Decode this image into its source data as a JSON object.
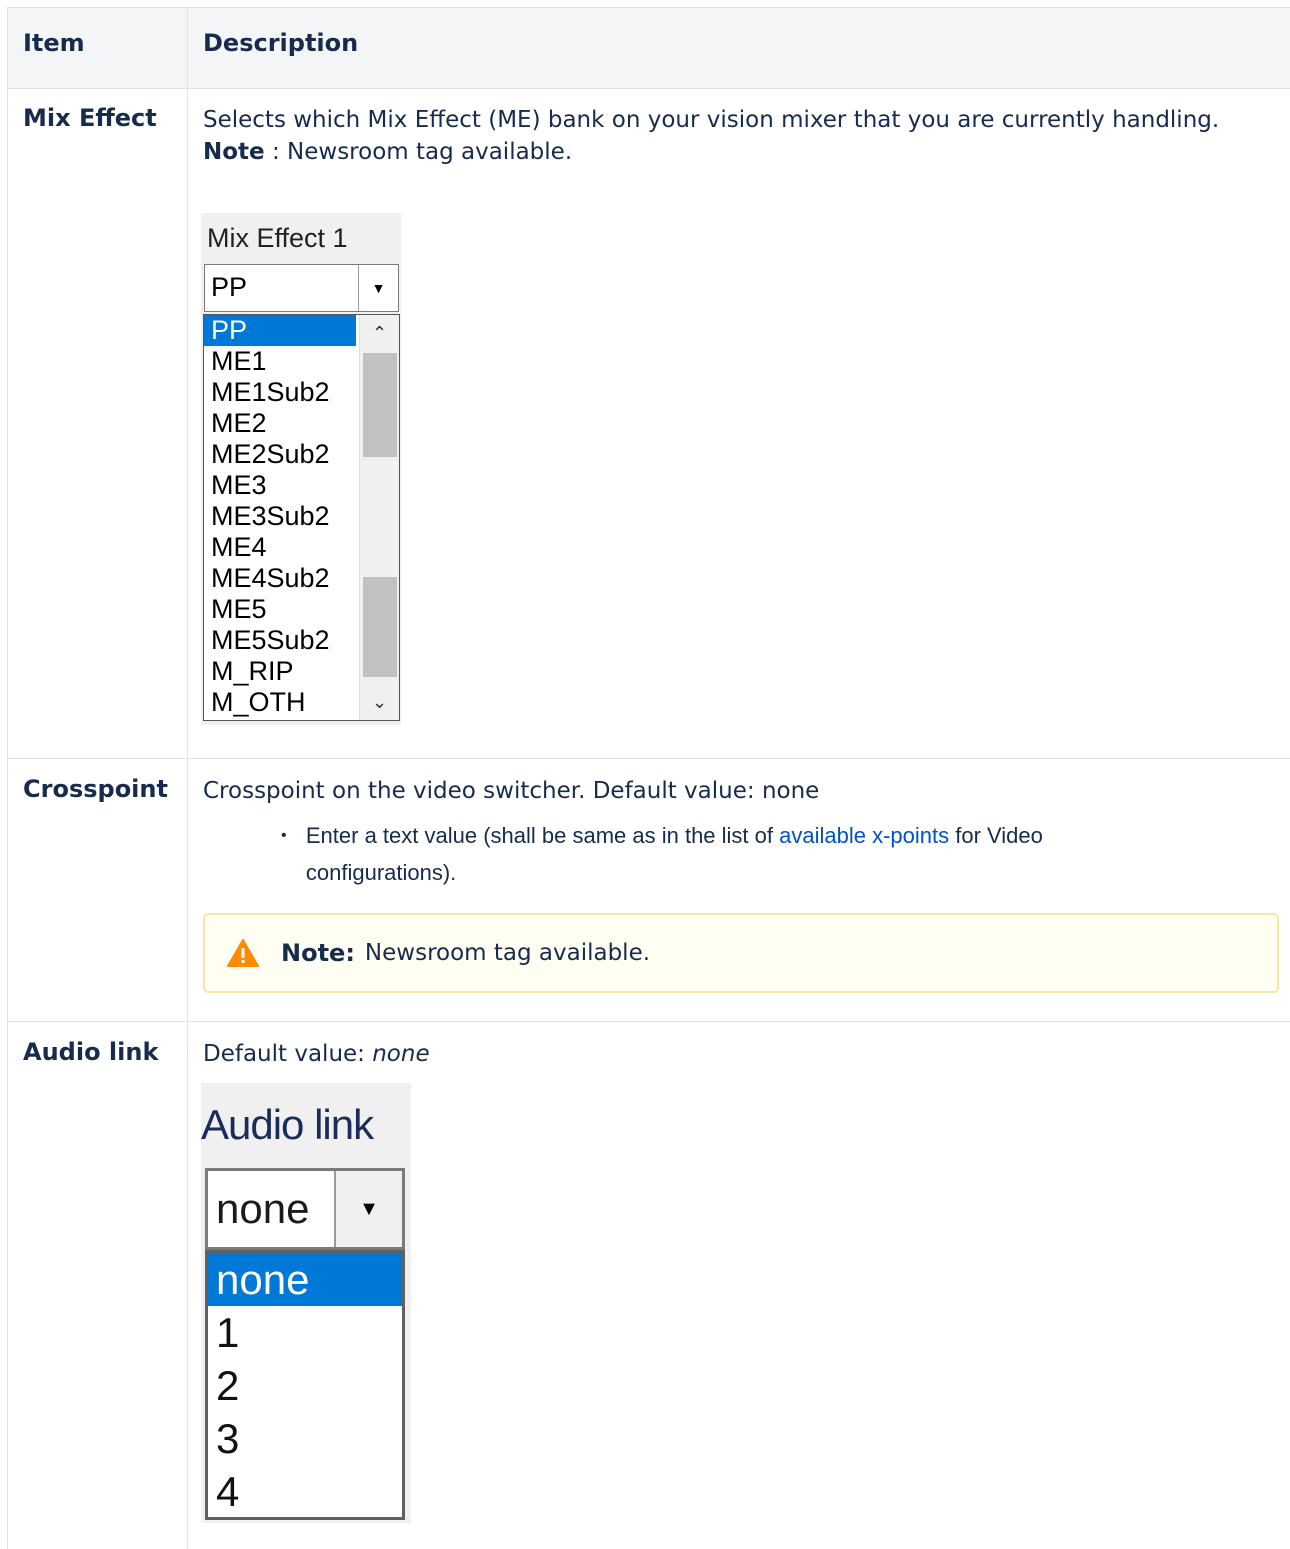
{
  "table": {
    "headers": {
      "item": "Item",
      "description": "Description"
    },
    "rows": {
      "mix_effect": {
        "item": "Mix Effect",
        "description": "Selects which Mix Effect (ME) bank on your vision mixer that you are currently handling.",
        "note_label": "Note",
        "note_text": " : Newsroom tag available.",
        "widget": {
          "label": "Mix Effect 1",
          "selected_value": "PP",
          "options": [
            "PP",
            "ME1",
            "ME1Sub2",
            "ME2",
            "ME2Sub2",
            "ME3",
            "ME3Sub2",
            "ME4",
            "ME4Sub2",
            "ME5",
            "ME5Sub2",
            "M_RIP",
            "M_OTH"
          ],
          "highlighted_index": 0
        }
      },
      "crosspoint": {
        "item": "Crosspoint",
        "description": "Crosspoint on the video switcher. Default value: none",
        "bullet_before": "Enter a text value (shall be same as in the list of ",
        "bullet_link": "available x-points",
        "bullet_after": " for Video configurations).",
        "note_label": "Note:",
        "note_text": "Newsroom tag available.",
        "note_icon": "warning-icon"
      },
      "audio_link": {
        "item": "Audio link",
        "description_prefix": "Default value: ",
        "description_value": "none",
        "widget": {
          "label": "Audio link",
          "selected_value": "none",
          "options": [
            "none",
            "1",
            "2",
            "3",
            "4"
          ],
          "highlighted_index": 0
        }
      }
    }
  },
  "colors": {
    "header_bg": "#f4f5f7",
    "highlight": "#0078d7",
    "link": "#0052cc",
    "warning": "#ff8b00"
  }
}
